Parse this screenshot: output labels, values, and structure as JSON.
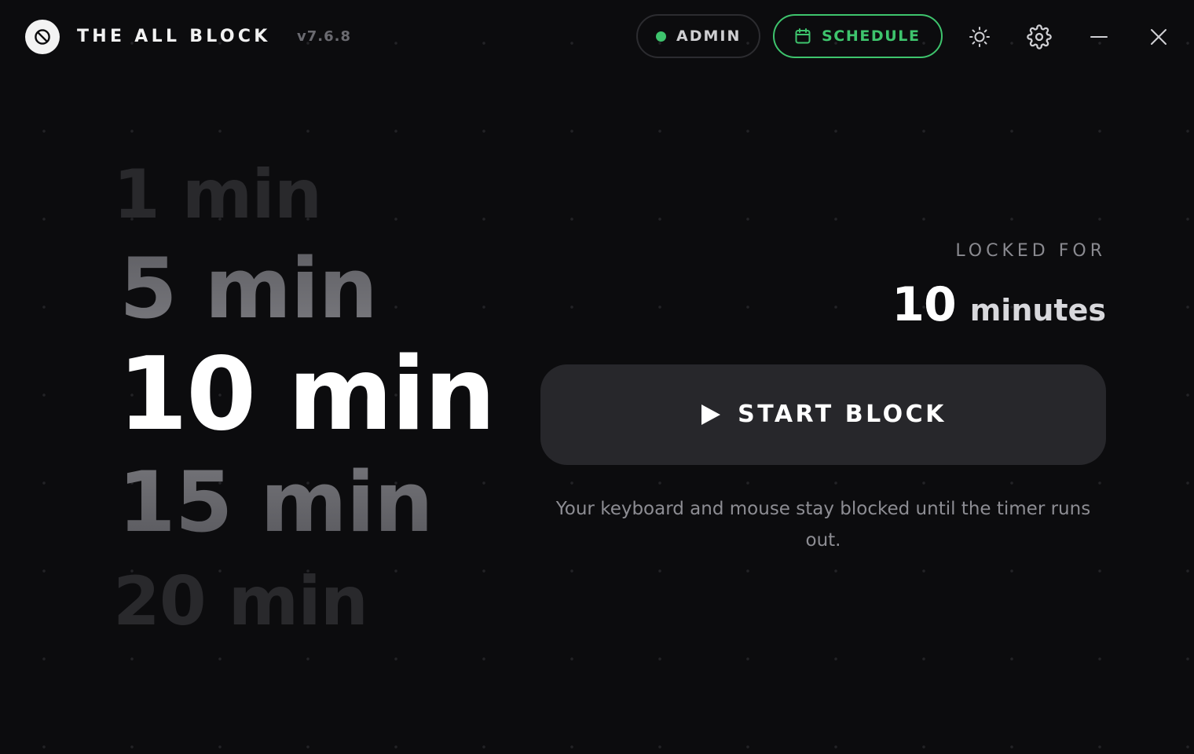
{
  "header": {
    "app_title": "THE ALL BLOCK",
    "version": "v7.6.8",
    "admin_label": "ADMIN",
    "admin_status_color": "#3ec46d",
    "schedule_label": "SCHEDULE",
    "schedule_icon": "calendar-icon",
    "theme_icon": "sun-icon",
    "settings_icon": "gear-icon",
    "minimize_icon": "minimize-icon",
    "close_icon": "close-icon",
    "logo_icon": "block-icon"
  },
  "durations": [
    {
      "label": "1 min",
      "state": "faded"
    },
    {
      "label": "5 min",
      "state": "near"
    },
    {
      "label": "10 min",
      "state": "selected"
    },
    {
      "label": "15 min",
      "state": "near"
    },
    {
      "label": "20 min",
      "state": "faded"
    }
  ],
  "lock": {
    "caption": "LOCKED FOR",
    "value": "10",
    "unit": "minutes"
  },
  "start_button": {
    "label": "START BLOCK",
    "icon": "play-icon"
  },
  "helper_text": "Your keyboard and mouse stay blocked until the timer runs out.",
  "colors": {
    "background": "#0c0c0e",
    "accent": "#3ec46d",
    "button_bg": "#27272b"
  }
}
